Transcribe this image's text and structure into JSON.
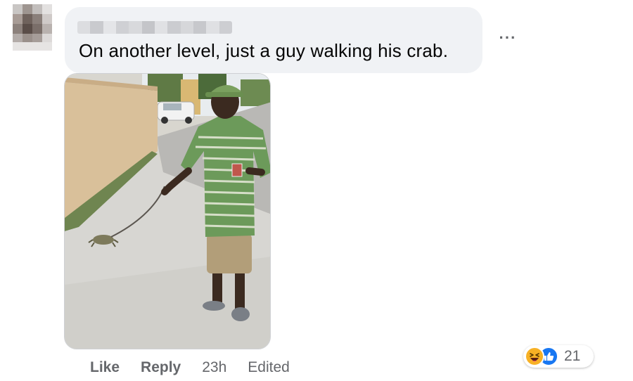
{
  "comment": {
    "text": "On another level, just a guy walking his crab.",
    "time": "23h",
    "edited_label": "Edited"
  },
  "actions": {
    "like_label": "Like",
    "reply_label": "Reply"
  },
  "reactions": {
    "icons": [
      "haha-icon",
      "like-icon"
    ],
    "count": "21"
  },
  "more_options": {
    "icon": "more-horizontal-icon",
    "glyph": "···"
  },
  "colors": {
    "bubble_bg": "#f0f2f5",
    "secondary_text": "#65676b",
    "like_blue": "#1877f2",
    "haha_yellow": "#f7b125"
  }
}
